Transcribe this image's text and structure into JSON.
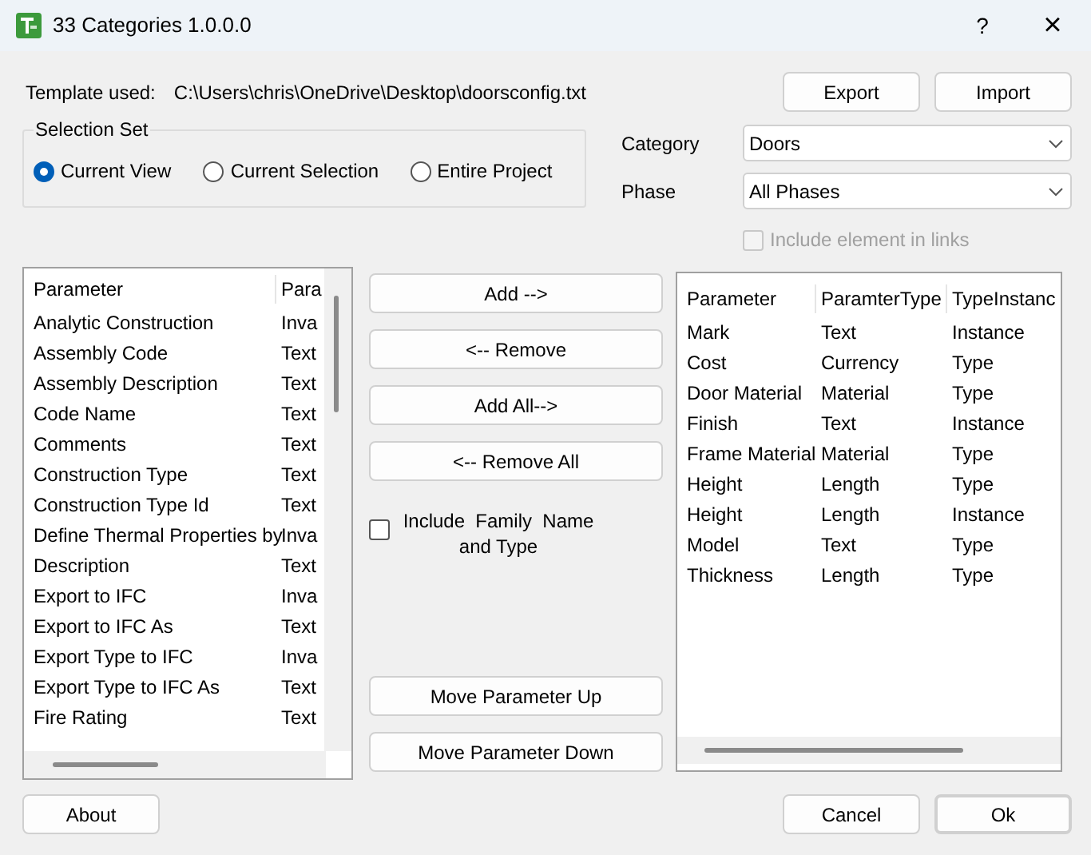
{
  "window": {
    "title": "33 Categories 1.0.0.0",
    "help": "?",
    "close": "×"
  },
  "template": {
    "label": "Template used:",
    "path": "C:\\Users\\chris\\OneDrive\\Desktop\\doorsconfig.txt"
  },
  "top_buttons": [
    "Export",
    "Import"
  ],
  "selection_set": {
    "title": "Selection Set",
    "options": [
      {
        "label": "Current View",
        "selected": true
      },
      {
        "label": "Current Selection",
        "selected": false
      },
      {
        "label": "Entire Project",
        "selected": false
      }
    ]
  },
  "category": {
    "label": "Category",
    "value": "Doors"
  },
  "phase": {
    "label": "Phase",
    "value": "All Phases"
  },
  "include_links": {
    "label": "Include element in links",
    "checked": false,
    "disabled": true
  },
  "available": {
    "columns": [
      "Parameter",
      "Para"
    ],
    "rows": [
      {
        "cells": [
          "Analytic Construction",
          "Inva"
        ]
      },
      {
        "cells": [
          "Assembly Code",
          "Text"
        ]
      },
      {
        "cells": [
          "Assembly Description",
          "Text"
        ]
      },
      {
        "cells": [
          "Code Name",
          "Text"
        ]
      },
      {
        "cells": [
          "Comments",
          "Text"
        ]
      },
      {
        "cells": [
          "Construction Type",
          "Text"
        ]
      },
      {
        "cells": [
          "Construction Type Id",
          "Text"
        ]
      },
      {
        "cells": [
          "Define Thermal Properties by",
          "Inva"
        ]
      },
      {
        "cells": [
          "Description",
          "Text"
        ]
      },
      {
        "cells": [
          "Export to IFC",
          "Inva"
        ]
      },
      {
        "cells": [
          "Export to IFC As",
          "Text"
        ]
      },
      {
        "cells": [
          "Export Type to IFC",
          "Inva"
        ]
      },
      {
        "cells": [
          "Export Type to IFC As",
          "Text"
        ]
      },
      {
        "cells": [
          "Fire Rating",
          "Text"
        ]
      }
    ]
  },
  "move_buttons": [
    "Add -->",
    "<-- Remove",
    "Add All-->",
    "<-- Remove All"
  ],
  "include_family": {
    "label": "Include  Family  Name and Type",
    "checked": false
  },
  "order_buttons": [
    "Move Parameter Up",
    "Move Parameter Down"
  ],
  "selected_params": {
    "columns": [
      "Parameter",
      "ParamterType",
      "TypeInstanc"
    ],
    "rows": [
      {
        "cells": [
          "Mark",
          "Text",
          "Instance"
        ]
      },
      {
        "cells": [
          "Cost",
          "Currency",
          "Type"
        ]
      },
      {
        "cells": [
          "Door Material",
          "Material",
          "Type"
        ]
      },
      {
        "cells": [
          "Finish",
          "Text",
          "Instance"
        ]
      },
      {
        "cells": [
          "Frame Material",
          "Material",
          "Type"
        ]
      },
      {
        "cells": [
          "Height",
          "Length",
          "Type"
        ]
      },
      {
        "cells": [
          "Height",
          "Length",
          "Instance"
        ]
      },
      {
        "cells": [
          "Model",
          "Text",
          "Type"
        ]
      },
      {
        "cells": [
          "Thickness",
          "Length",
          "Type"
        ]
      }
    ]
  },
  "bottom_left_button": "About",
  "bottom_buttons": [
    {
      "label": "Cancel",
      "kind": "normal"
    },
    {
      "label": "Ok",
      "kind": "default"
    }
  ]
}
